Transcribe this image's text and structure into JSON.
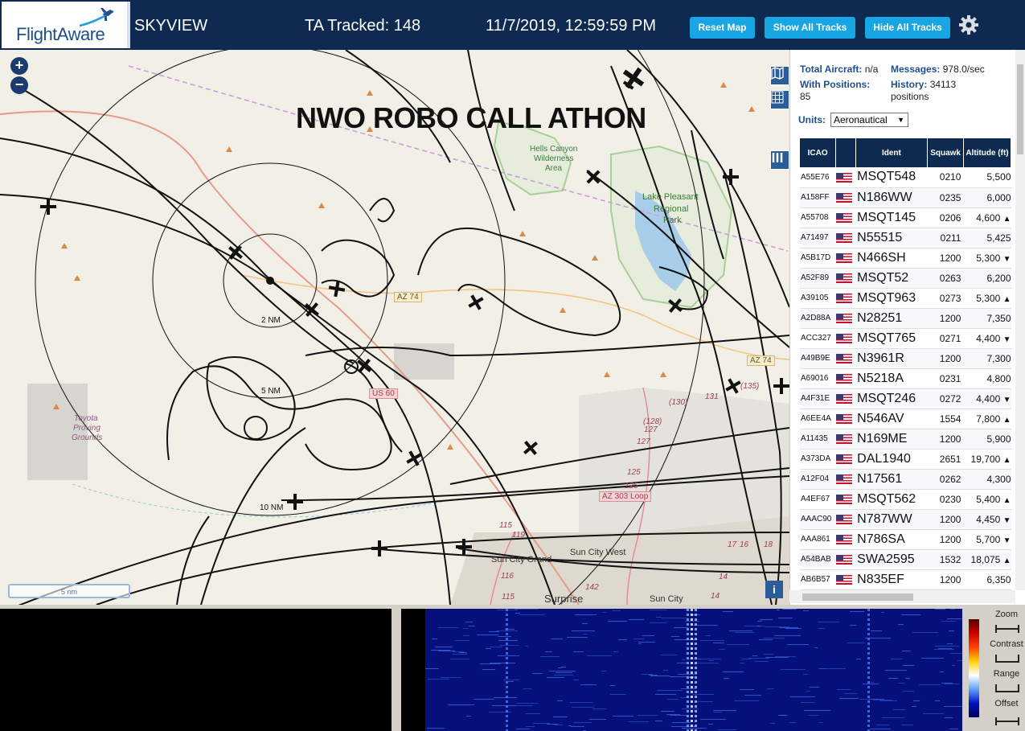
{
  "header": {
    "logo_text": "FlightAware",
    "app_name": "SKYVIEW",
    "tracked": "TA Tracked: 148",
    "datetime": "11/7/2019, 12:59:59 PM",
    "buttons": [
      "Reset Map",
      "Show All Tracks",
      "Hide All Tracks"
    ],
    "settings_icon": "gear-icon"
  },
  "map": {
    "overlay_title": "NWO ROBO CALL ATHON",
    "scale_label": "5 nm",
    "zoom_in": "+",
    "zoom_out": "−",
    "info": "i",
    "range_labels": [
      "2 NM",
      "5 NM",
      "10 NM"
    ],
    "place_labels": [
      "Hells Canyon",
      "Wilderness",
      "Area",
      "Lake Pleasant",
      "Regional",
      "Park",
      "Toyota",
      "Proving",
      "Grounds",
      "Sun City Grand",
      "Sun City West",
      "Surprise",
      "Sun City"
    ],
    "road_labels": [
      "AZ 74",
      "AZ 74",
      "US 60",
      "AZ 303 Loop"
    ],
    "highway_numbers": [
      "(130)",
      "131",
      "(135)",
      "(128)",
      "127",
      "127",
      "125",
      "125",
      "119",
      "115",
      "116",
      "115",
      "142",
      "14",
      "14",
      "17",
      "16",
      "18"
    ]
  },
  "panel": {
    "total_aircraft_label": "Total Aircraft:",
    "total_aircraft_value": "n/a",
    "messages_label": "Messages:",
    "messages_value": "978.0/sec",
    "with_positions_label": "With Positions:",
    "with_positions_value": "85",
    "history_label": "History:",
    "history_value": "34113",
    "history_unit": "positions",
    "units_label": "Units:",
    "units_value": "Aeronautical",
    "columns": [
      "ICAO",
      "",
      "Ident",
      "Squawk",
      "Altitude (ft)"
    ],
    "rows": [
      {
        "icao": "A55E76",
        "ident": "MSQT548",
        "squawk": "0210",
        "alt": "5,500",
        "trend": ""
      },
      {
        "icao": "A158FF",
        "ident": "N186WW",
        "squawk": "0235",
        "alt": "6,000",
        "trend": ""
      },
      {
        "icao": "A55708",
        "ident": "MSQT145",
        "squawk": "0206",
        "alt": "4,600",
        "trend": "▲"
      },
      {
        "icao": "A71497",
        "ident": "N55515",
        "squawk": "0211",
        "alt": "5,425",
        "trend": ""
      },
      {
        "icao": "A5B17D",
        "ident": "N466SH",
        "squawk": "1200",
        "alt": "5,300",
        "trend": "▼"
      },
      {
        "icao": "A52F89",
        "ident": "MSQT52",
        "squawk": "0263",
        "alt": "6,200",
        "trend": ""
      },
      {
        "icao": "A39105",
        "ident": "MSQT963",
        "squawk": "0273",
        "alt": "5,300",
        "trend": "▲"
      },
      {
        "icao": "A2D88A",
        "ident": "N28251",
        "squawk": "1200",
        "alt": "7,350",
        "trend": ""
      },
      {
        "icao": "ACC327",
        "ident": "MSQT765",
        "squawk": "0271",
        "alt": "4,400",
        "trend": "▼"
      },
      {
        "icao": "A49B9E",
        "ident": "N3961R",
        "squawk": "1200",
        "alt": "7,300",
        "trend": ""
      },
      {
        "icao": "A69016",
        "ident": "N5218A",
        "squawk": "0231",
        "alt": "4,800",
        "trend": ""
      },
      {
        "icao": "A4F31E",
        "ident": "MSQT246",
        "squawk": "0272",
        "alt": "4,400",
        "trend": "▼"
      },
      {
        "icao": "A6EE4A",
        "ident": "N546AV",
        "squawk": "1554",
        "alt": "7,800",
        "trend": "▲"
      },
      {
        "icao": "A11435",
        "ident": "N169ME",
        "squawk": "1200",
        "alt": "5,900",
        "trend": ""
      },
      {
        "icao": "A373DA",
        "ident": "DAL1940",
        "squawk": "2651",
        "alt": "19,700",
        "trend": "▲"
      },
      {
        "icao": "A12F04",
        "ident": "N17561",
        "squawk": "0262",
        "alt": "4,300",
        "trend": ""
      },
      {
        "icao": "A4EF67",
        "ident": "MSQT562",
        "squawk": "0230",
        "alt": "5,400",
        "trend": "▲"
      },
      {
        "icao": "AAAC90",
        "ident": "N787WW",
        "squawk": "1200",
        "alt": "4,450",
        "trend": "▼"
      },
      {
        "icao": "AAA861",
        "ident": "N786SA",
        "squawk": "1200",
        "alt": "5,700",
        "trend": "▼"
      },
      {
        "icao": "A54BAB",
        "ident": "SWA2595",
        "squawk": "1532",
        "alt": "18,075",
        "trend": "▲"
      },
      {
        "icao": "AB6B57",
        "ident": "N835EF",
        "squawk": "1200",
        "alt": "6,350",
        "trend": ""
      }
    ]
  },
  "spectrum": {
    "controls": [
      "Zoom",
      "Contrast",
      "Range",
      "Offset"
    ]
  }
}
